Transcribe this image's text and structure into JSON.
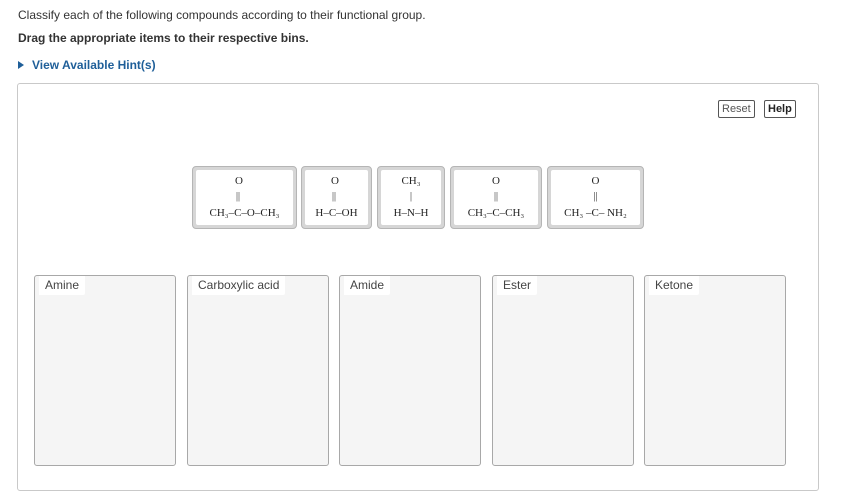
{
  "question": "Classify each of the following compounds according to their functional group.",
  "instruction": "Drag the appropriate items to their respective bins.",
  "hint_label": "View Available Hint(s)",
  "buttons": {
    "reset": "Reset",
    "help": "Help"
  },
  "tiles": [
    {
      "top": "O",
      "bond": "||",
      "formula": "CH₃–C–O–CH₃"
    },
    {
      "top": "O",
      "bond": "||",
      "formula": "H–C–OH"
    },
    {
      "top": "CH₃",
      "bond": "|",
      "formula": "H–N–H"
    },
    {
      "top": "O",
      "bond": "||",
      "formula": "CH₃–C–CH₃"
    },
    {
      "top": "O",
      "bond": "||",
      "formula": "CH₃ –C– NH₂"
    }
  ],
  "bins": [
    "Amine",
    "Carboxylic acid",
    "Amide",
    "Ester",
    "Ketone"
  ]
}
